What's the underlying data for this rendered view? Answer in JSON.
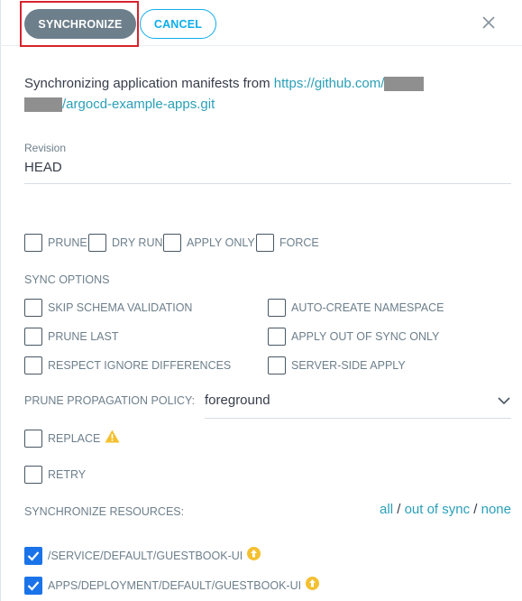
{
  "header": {
    "synchronize_label": "SYNCHRONIZE",
    "cancel_label": "CANCEL",
    "close_icon": "close-icon"
  },
  "message": {
    "prefix": "Synchronizing application manifests from ",
    "link_part1": "https://github.com/",
    "link_part2": "/argocd-example-apps.git"
  },
  "revision": {
    "label": "Revision",
    "value": "HEAD"
  },
  "top_options": [
    {
      "label": "PRUNE",
      "checked": false
    },
    {
      "label": "DRY RUN",
      "checked": false
    },
    {
      "label": "APPLY ONLY",
      "checked": false
    },
    {
      "label": "FORCE",
      "checked": false
    }
  ],
  "sync_options": {
    "heading": "SYNC OPTIONS",
    "left": [
      {
        "label": "SKIP SCHEMA VALIDATION",
        "checked": false
      },
      {
        "label": "PRUNE LAST",
        "checked": false
      },
      {
        "label": "RESPECT IGNORE DIFFERENCES",
        "checked": false
      }
    ],
    "right": [
      {
        "label": "AUTO-CREATE NAMESPACE",
        "checked": false
      },
      {
        "label": "APPLY OUT OF SYNC ONLY",
        "checked": false
      },
      {
        "label": "SERVER-SIDE APPLY",
        "checked": false
      }
    ]
  },
  "prune_policy": {
    "label": "PRUNE PROPAGATION POLICY:",
    "value": "foreground"
  },
  "replace": {
    "label": "REPLACE",
    "checked": false,
    "icon": "warning-icon"
  },
  "retry": {
    "label": "RETRY",
    "checked": false
  },
  "sync_resources": {
    "label": "SYNCHRONIZE RESOURCES:",
    "all": "all",
    "out_of_sync": "out of sync",
    "none": "none",
    "sep": "/"
  },
  "resources": [
    {
      "label": "/SERVICE/DEFAULT/GUESTBOOK-UI",
      "checked": true,
      "icon": "out-of-sync-icon"
    },
    {
      "label": "APPS/DEPLOYMENT/DEFAULT/GUESTBOOK-UI",
      "checked": true,
      "icon": "out-of-sync-icon"
    }
  ],
  "colors": {
    "primary_button": "#6d7f8b",
    "secondary_button": "#0dadea",
    "link": "#2a9fb8",
    "checkbox_checked": "#1a73e8",
    "highlight": "#d9232d",
    "warning": "#f4c030"
  }
}
